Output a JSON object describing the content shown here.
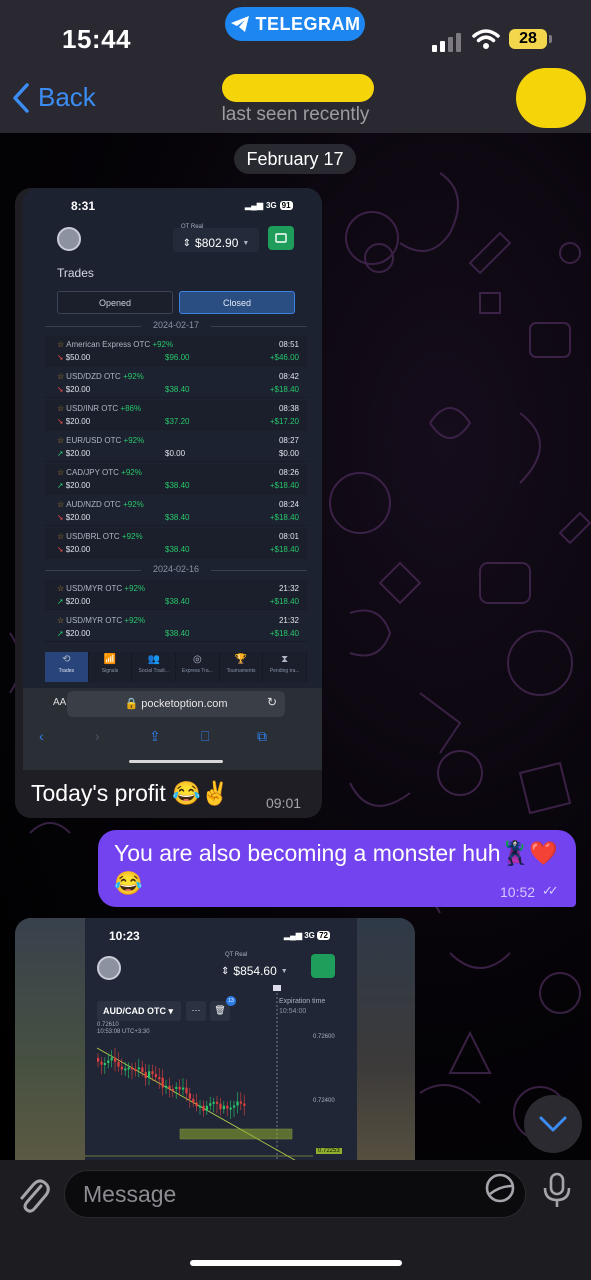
{
  "status_bar": {
    "time": "15:44",
    "app_pill": "TELEGRAM",
    "battery": "28"
  },
  "header": {
    "back_label": "Back",
    "subtitle": "last seen recently"
  },
  "date_divider": "February 17",
  "message1": {
    "screenshot": {
      "phone_time": "8:31",
      "network": "3G",
      "phone_battery": "91",
      "account_type": "QT Real",
      "balance": "$802.90",
      "section_title": "Trades",
      "tabs": [
        "Opened",
        "Closed"
      ],
      "active_tab": "Closed",
      "groups": [
        {
          "date": "2024-02-17",
          "rows": [
            {
              "pair": "American Express OTC",
              "pct": "+92%",
              "dir": "down",
              "amount": "$50.00",
              "return": "$96.00",
              "time": "08:51",
              "profit": "+$46.00"
            },
            {
              "pair": "USD/DZD OTC",
              "pct": "+92%",
              "dir": "down",
              "amount": "$20.00",
              "return": "$38.40",
              "time": "08:42",
              "profit": "+$18.40"
            },
            {
              "pair": "USD/INR OTC",
              "pct": "+86%",
              "dir": "down",
              "amount": "$20.00",
              "return": "$37.20",
              "time": "08:38",
              "profit": "+$17.20"
            },
            {
              "pair": "EUR/USD OTC",
              "pct": "+92%",
              "dir": "up",
              "amount": "$20.00",
              "return": "$0.00",
              "time": "08:27",
              "profit": "$0.00"
            },
            {
              "pair": "CAD/JPY OTC",
              "pct": "+92%",
              "dir": "up",
              "amount": "$20.00",
              "return": "$38.40",
              "time": "08:26",
              "profit": "+$18.40"
            },
            {
              "pair": "AUD/NZD OTC",
              "pct": "+92%",
              "dir": "down",
              "amount": "$20.00",
              "return": "$38.40",
              "time": "08:24",
              "profit": "+$18.40"
            },
            {
              "pair": "USD/BRL OTC",
              "pct": "+92%",
              "dir": "down",
              "amount": "$20.00",
              "return": "$38.40",
              "time": "08:01",
              "profit": "+$18.40"
            }
          ]
        },
        {
          "date": "2024-02-16",
          "rows": [
            {
              "pair": "USD/MYR OTC",
              "pct": "+92%",
              "dir": "up",
              "amount": "$20.00",
              "return": "$38.40",
              "time": "21:32",
              "profit": "+$18.40"
            },
            {
              "pair": "USD/MYR OTC",
              "pct": "+92%",
              "dir": "up",
              "amount": "$20.00",
              "return": "$38.40",
              "time": "21:32",
              "profit": "+$18.40"
            }
          ]
        }
      ],
      "bottom_nav": [
        "Trades",
        "Signals",
        "Social Tradi...",
        "Express Tra...",
        "Tournaments",
        "Pending tra..."
      ],
      "address_aa": "AA",
      "url": "pocketoption.com"
    },
    "caption": "Today's profit 😂✌️",
    "time": "09:01"
  },
  "message2": {
    "text": "You are also becoming a monster huh🦹‍♀️❤️ 😂",
    "time": "10:52"
  },
  "message3": {
    "screenshot": {
      "phone_time": "10:23",
      "network": "3G",
      "phone_battery": "72",
      "account_type": "QT Real",
      "balance": "$854.60",
      "asset": "AUD/CAD OTC",
      "more_button": "···",
      "badge": "13",
      "expiration_label": "Expiration time",
      "expiration_value": "10:54:00",
      "price_label_a": "0.72610",
      "price_label_b": "10:53:08 UTC+3:30",
      "axis_ticks": [
        "0.72600",
        "0.72400",
        "0.72253"
      ]
    }
  },
  "composer": {
    "placeholder": "Message"
  },
  "colors": {
    "accent": "#3b8df4",
    "outgoing_bubble": "#7443f0",
    "telegram_pill": "#1d86f0"
  },
  "icons": [
    "back-chevron-icon",
    "telegram-plane-icon",
    "signal-icon",
    "wifi-icon",
    "paperclip-icon",
    "sticker-icon",
    "mic-icon",
    "chevron-down-icon"
  ]
}
